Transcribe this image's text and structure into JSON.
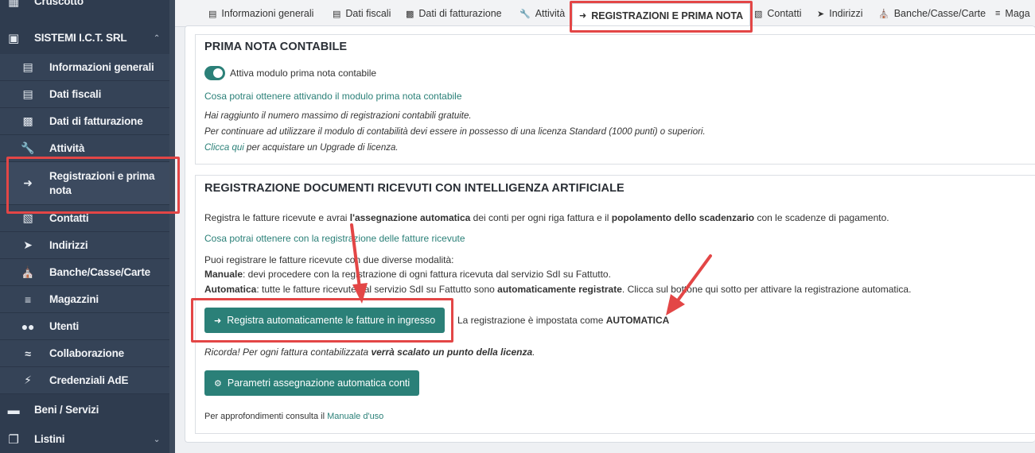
{
  "sidebar": {
    "top_cut": {
      "label": "Cruscotto",
      "icon": "dashboard-icon"
    },
    "company": {
      "label": "SISTEMI I.C.T. SRL",
      "icon": "building-icon"
    },
    "items": [
      {
        "label": "Informazioni generali",
        "icon": "id-card-icon"
      },
      {
        "label": "Dati fiscali",
        "icon": "archive-icon"
      },
      {
        "label": "Dati di fatturazione",
        "icon": "money-bill-icon"
      },
      {
        "label": "Attività",
        "icon": "wrench-icon"
      },
      {
        "label": "Registrazioni e prima nota",
        "icon": "sign-in-icon"
      },
      {
        "label": "Contatti",
        "icon": "address-book-icon"
      },
      {
        "label": "Indirizzi",
        "icon": "location-arrow-icon"
      },
      {
        "label": "Banche/Casse/Carte",
        "icon": "bank-icon"
      },
      {
        "label": "Magazzini",
        "icon": "warehouse-icon"
      },
      {
        "label": "Utenti",
        "icon": "users-icon"
      },
      {
        "label": "Collaborazione",
        "icon": "handshake-icon"
      },
      {
        "label": "Credenziali AdE",
        "icon": "plug-icon"
      }
    ],
    "beni": {
      "label": "Beni / Servizi",
      "icon": "shopping-basket-icon"
    },
    "listini": {
      "label": "Listini",
      "icon": "copy-icon"
    }
  },
  "tabs": [
    {
      "label": "Informazioni generali"
    },
    {
      "label": "Dati fiscali"
    },
    {
      "label": "Dati di fatturazione"
    },
    {
      "label": "Attività"
    },
    {
      "label": "REGISTRAZIONI E PRIMA NOTA"
    },
    {
      "label": "Contatti"
    },
    {
      "label": "Indirizzi"
    },
    {
      "label": "Banche/Casse/Carte"
    },
    {
      "label": "Maga"
    }
  ],
  "prima_nota": {
    "title": "PRIMA NOTA CONTABILE",
    "toggle_label": "Attiva modulo prima nota contabile",
    "link": "Cosa potrai ottenere attivando il modulo prima nota contabile",
    "note1": "Hai raggiunto il numero massimo di registrazioni contabili gratuite.",
    "note2": "Per continuare ad utilizzare il modulo di contabilità devi essere in possesso di una licenza Standard (1000 punti) o superiori.",
    "note3_link": "Clicca qui",
    "note3_rest": " per acquistare un Upgrade di licenza."
  },
  "ai_section": {
    "title": "REGISTRAZIONE DOCUMENTI RICEVUTI CON INTELLIGENZA ARTIFICIALE",
    "intro_a": "Registra le fatture ricevute e avrai ",
    "intro_b": "l'assegnazione automatica",
    "intro_c": " dei conti per ogni riga fattura e il ",
    "intro_d": "popolamento dello scadenzario",
    "intro_e": " con le scadenze di pagamento.",
    "link": "Cosa potrai ottenere con la registrazione delle fatture ricevute",
    "modes_intro": "Puoi registrare le fatture ricevute con due diverse modalità:",
    "manual_label": "Manuale",
    "manual_text": ": devi procedere con la registrazione di ogni fattura ricevuta dal servizio SdI su Fattutto.",
    "auto_label": "Automatica",
    "auto_text_a": ": tutte le fatture ricevute dal servizio SdI su Fattutto sono ",
    "auto_text_b": "automaticamente registrate",
    "auto_text_c": ". Clicca sul bottone qui sotto per attivare la registrazione automatica.",
    "register_button": "Registra automaticamente le fatture in ingresso",
    "status_a": "La registrazione è impostata come ",
    "status_b": "AUTOMATICA",
    "reminder_a": "Ricorda! Per ogni fattura contabilizzata ",
    "reminder_b": "verrà scalato un punto della licenza",
    "reminder_c": ".",
    "params_button": "Parametri assegnazione automatica conti",
    "footer_a": "Per approfondimenti consulta il ",
    "footer_link": "Manuale d'uso"
  },
  "colors": {
    "accent": "#2b8078",
    "highlight": "#e34646",
    "sidebar": "#2f3c4f"
  }
}
